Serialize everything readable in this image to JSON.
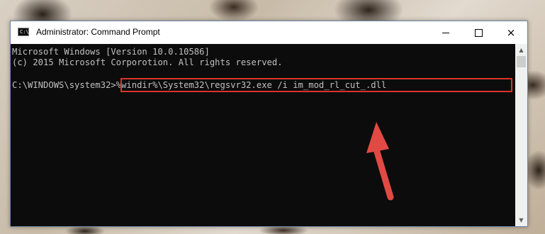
{
  "window": {
    "title": "Administrator: Command Prompt",
    "icon": "cmd-icon",
    "controls": {
      "minimize": "minimize-icon",
      "maximize": "maximize-icon",
      "close": "×"
    }
  },
  "console": {
    "line1": "Microsoft Windows [Version 10.0.10586]",
    "line2": "(c) 2015 Microsoft Corporotion. All rights reserved.",
    "prompt": "C:\\WINDOWS\\system32>",
    "command": "%windir%\\System32\\regsvr32.exe /i im_mod_rl_cut_.dll"
  },
  "annotation": {
    "highlight_color": "#d9342b",
    "arrow_color": "#e14a44"
  },
  "scrollbar": {
    "up": "▲",
    "down": "▼"
  }
}
